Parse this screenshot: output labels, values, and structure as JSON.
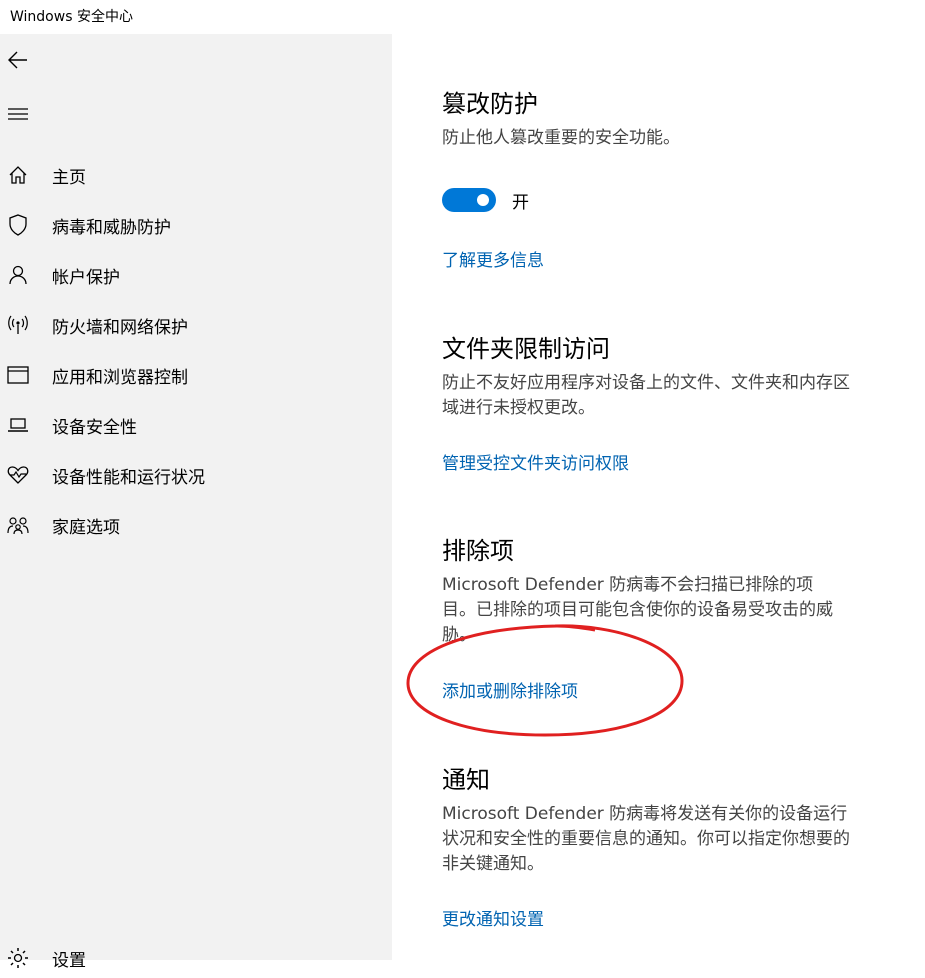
{
  "window": {
    "title": "Windows 安全中心"
  },
  "sidebar": {
    "back_icon": "back-arrow-icon",
    "menu_icon": "hamburger-menu-icon",
    "items": [
      {
        "label": "主页",
        "icon": "home-icon"
      },
      {
        "label": "病毒和威胁防护",
        "icon": "shield-icon"
      },
      {
        "label": "帐户保护",
        "icon": "person-icon"
      },
      {
        "label": "防火墙和网络保护",
        "icon": "antenna-icon"
      },
      {
        "label": "应用和浏览器控制",
        "icon": "app-window-icon"
      },
      {
        "label": "设备安全性",
        "icon": "laptop-icon"
      },
      {
        "label": "设备性能和运行状况",
        "icon": "heart-pulse-icon"
      },
      {
        "label": "家庭选项",
        "icon": "family-icon"
      }
    ],
    "settings": {
      "label": "设置",
      "icon": "gear-icon"
    }
  },
  "main": {
    "tamper": {
      "title": "篡改防护",
      "description": "防止他人篡改重要的安全功能。",
      "toggle_state": "开",
      "toggle_on": true,
      "link": "了解更多信息"
    },
    "folder_access": {
      "title": "文件夹限制访问",
      "description": "防止不友好应用程序对设备上的文件、文件夹和内存区域进行未授权更改。",
      "link": "管理受控文件夹访问权限"
    },
    "exclusions": {
      "title": "排除项",
      "description": "Microsoft Defender 防病毒不会扫描已排除的项目。已排除的项目可能包含使你的设备易受攻击的威胁。",
      "link": "添加或删除排除项"
    },
    "notifications": {
      "title": "通知",
      "description": "Microsoft Defender 防病毒将发送有关你的设备运行状况和安全性的重要信息的通知。你可以指定你想要的非关键通知。",
      "link": "更改通知设置"
    }
  },
  "colors": {
    "accent": "#0078d7",
    "link": "#0063b1",
    "sidebar_bg": "#f2f2f2",
    "annotation": "#e02020"
  }
}
